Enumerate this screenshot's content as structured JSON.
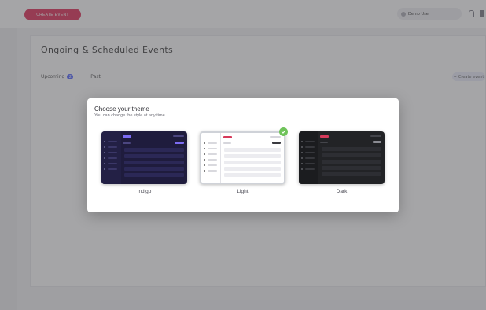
{
  "topbar": {
    "create_label": "CREATE EVENT",
    "user_name": "Demo User"
  },
  "page": {
    "title": "Ongoing & Scheduled Events",
    "tabs": [
      {
        "label": "Upcoming",
        "count": "2"
      },
      {
        "label": "Past"
      }
    ],
    "right_action": "Create event"
  },
  "modal": {
    "title": "Choose your theme",
    "subtitle": "You can change the style at any time.",
    "themes": [
      {
        "label": "Indigo",
        "selected": false,
        "bg": "#1f1c3d",
        "sidebar": "#232045",
        "accent": "#7c6cf2"
      },
      {
        "label": "Light",
        "selected": true,
        "bg": "#ffffff",
        "sidebar": "#ffffff",
        "accent": "#d63a5b"
      },
      {
        "label": "Dark",
        "selected": false,
        "bg": "#222326",
        "sidebar": "#1b1c1f",
        "accent": "#d63a5b"
      }
    ]
  },
  "colors": {
    "check": "#6fc35a",
    "overlay": "rgba(40,40,46,0.42)"
  }
}
